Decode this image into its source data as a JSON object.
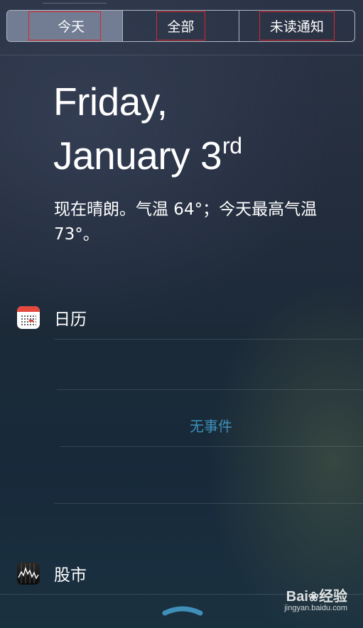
{
  "tabs": [
    {
      "label": "今天",
      "active": true
    },
    {
      "label": "全部",
      "active": false
    },
    {
      "label": "未读通知",
      "active": false
    }
  ],
  "date": {
    "line1": "Friday,",
    "line2_main": "January 3",
    "line2_suffix": "rd"
  },
  "weather_summary": "现在晴朗。气温 64°；今天最高气温 73°。",
  "calendar": {
    "title": "日历",
    "icon": "calendar-icon",
    "empty_message": "无事件"
  },
  "stocks": {
    "title": "股市",
    "icon": "stocks-icon"
  },
  "footer": {
    "icon": "chevron-up-icon"
  },
  "watermark": {
    "logo_text": "Bai",
    "logo_suffix": "经验",
    "site": "jingyan.baidu.com"
  },
  "colors": {
    "accent_text": "#3d8fb6",
    "highlight_box": "#d8262b",
    "calendar_red": "#e5483d"
  }
}
